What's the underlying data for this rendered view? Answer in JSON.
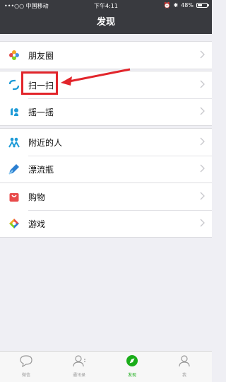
{
  "status_bar": {
    "carrier": "•••○○ 中国移动",
    "time": "下午4:11",
    "battery": "48%",
    "battery_level": 0.48
  },
  "nav": {
    "title": "发现"
  },
  "groups": [
    {
      "items": [
        {
          "label": "朋友圈",
          "icon": "moments-icon"
        }
      ]
    },
    {
      "items": [
        {
          "label": "扫一扫",
          "icon": "scan-icon"
        },
        {
          "label": "摇一摇",
          "icon": "shake-icon"
        }
      ]
    },
    {
      "items": [
        {
          "label": "附近的人",
          "icon": "nearby-icon"
        },
        {
          "label": "漂流瓶",
          "icon": "drift-bottle-icon"
        }
      ]
    },
    {
      "items": [
        {
          "label": "购物",
          "icon": "shopping-icon"
        },
        {
          "label": "游戏",
          "icon": "games-icon"
        }
      ]
    }
  ],
  "tabbar": {
    "items": [
      {
        "label": "微信",
        "icon": "chat-icon",
        "active": false
      },
      {
        "label": "通讯录",
        "icon": "contacts-icon",
        "active": false
      },
      {
        "label": "发现",
        "icon": "discover-icon",
        "active": true
      },
      {
        "label": "我",
        "icon": "me-icon",
        "active": false
      }
    ]
  },
  "colors": {
    "nav_bg": "#393a3f",
    "accent": "#1aad19",
    "highlight": "#e2252b",
    "bg": "#efeff4"
  }
}
